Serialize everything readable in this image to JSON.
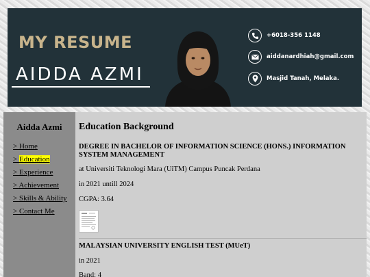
{
  "banner": {
    "title": "MY RESUME",
    "name": "AIDDA AZMI",
    "contacts": [
      {
        "icon": "phone-icon",
        "text": "+6018-356 1148"
      },
      {
        "icon": "mail-icon",
        "text": "aiddanardhiah@gmail.com"
      },
      {
        "icon": "location-pin-icon",
        "text": "Masjid Tanah, Melaka."
      }
    ]
  },
  "sidebar": {
    "name": "Aidda Azmi",
    "nav": [
      {
        "prefix": "> ",
        "label": "Home"
      },
      {
        "prefix": "> ",
        "label": "Education",
        "active": true
      },
      {
        "prefix": "> ",
        "label": "Experience"
      },
      {
        "prefix": "> ",
        "label": "Achievement"
      },
      {
        "prefix": "> ",
        "label": "Skills & Ability"
      },
      {
        "prefix": "> ",
        "label": "Contact Me"
      }
    ]
  },
  "main": {
    "heading": "Education Background",
    "degree": {
      "title": "DEGREE IN BACHELOR OF INFORMATION SCIENCE (HONS.) INFORMATION SYSTEM MANAGEMENT",
      "institution": "at Universiti Teknologi Mara (UiTM) Campus Puncak Perdana",
      "period": "in 2021 untill 2024",
      "cgpa": "CGPA: 3.64"
    },
    "muet": {
      "title": "MALAYSIAN UNIVERSITY ENGLISH TEST (MUeT)",
      "year": "in 2021",
      "band": "Band: 4"
    }
  },
  "colors": {
    "banner_bg": "#223239",
    "title_gold": "#c8b48c",
    "sidebar_bg": "#8b8b8b",
    "main_bg": "#cfcfcf",
    "active_highlight": "#ffff00"
  }
}
